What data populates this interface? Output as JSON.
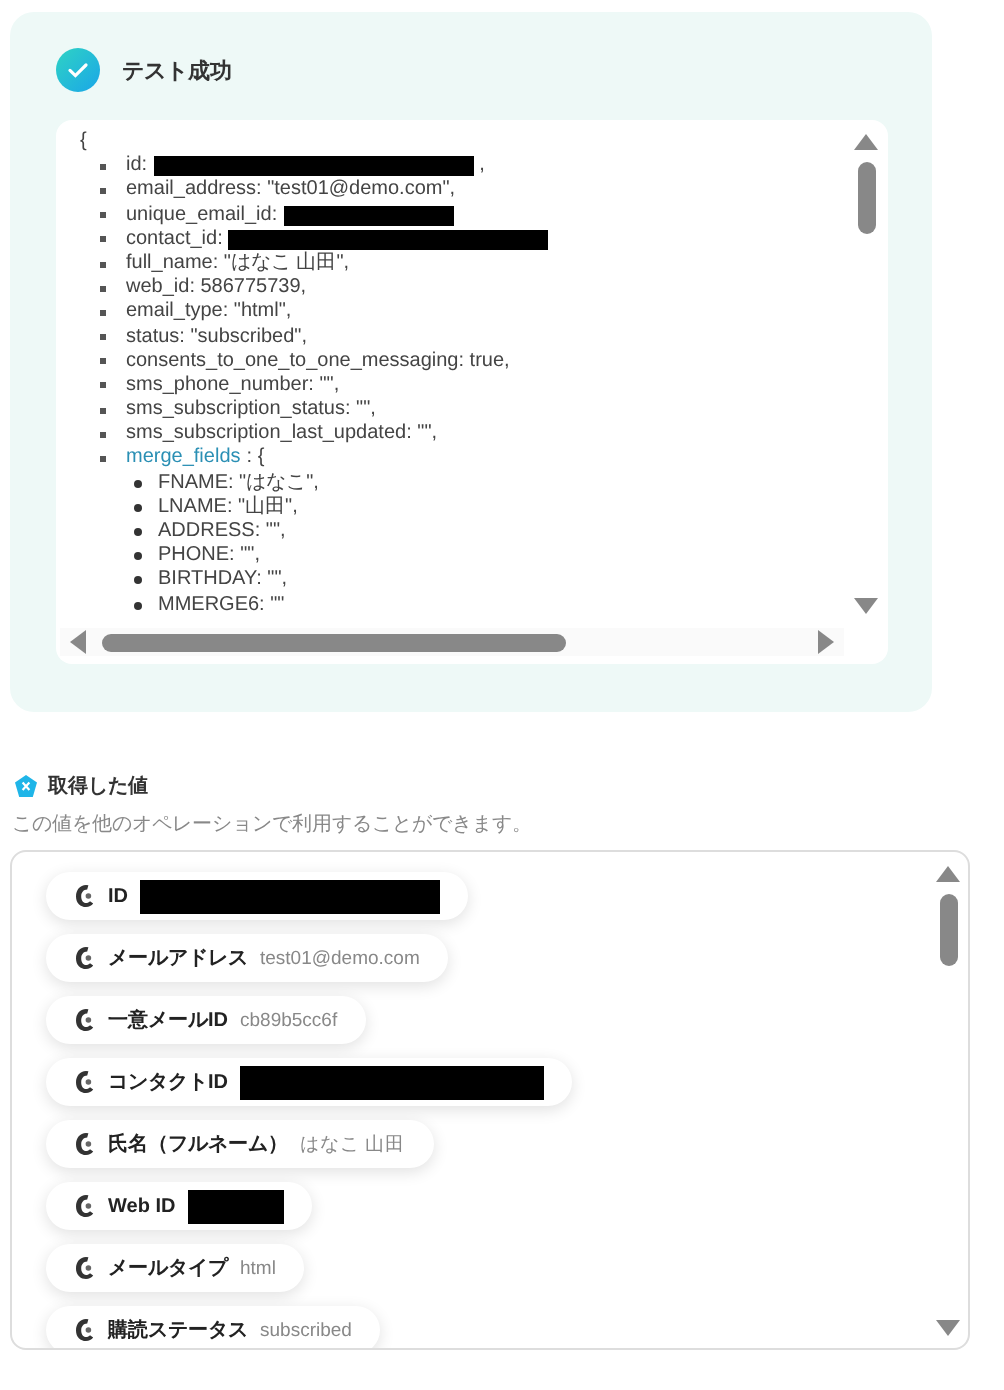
{
  "test_result": {
    "passed": true,
    "title": "テスト成功"
  },
  "json_view": {
    "open": "{",
    "lines": [
      {
        "kind": "redacted",
        "key": "id:",
        "suffix": ","
      },
      {
        "kind": "text",
        "text": "email_address: \"test01@demo.com\","
      },
      {
        "kind": "redacted",
        "key": "unique_email_id:"
      },
      {
        "kind": "redacted",
        "key": "contact_id:"
      },
      {
        "kind": "text",
        "text": "full_name: \"はなこ 山田\","
      },
      {
        "kind": "text",
        "text": "web_id: 586775739,"
      },
      {
        "kind": "text",
        "text": "email_type: \"html\","
      },
      {
        "kind": "text",
        "text": "status: \"subscribed\","
      },
      {
        "kind": "text",
        "text": "consents_to_one_to_one_messaging: true,"
      },
      {
        "kind": "text",
        "text": "sms_phone_number: \"\","
      },
      {
        "kind": "text",
        "text": "sms_subscription_status: \"\","
      },
      {
        "kind": "text",
        "text": "sms_subscription_last_updated: \"\","
      },
      {
        "kind": "object",
        "key": "merge_fields",
        "rest": ": {",
        "children": [
          {
            "text": "FNAME: \"はなこ\","
          },
          {
            "text": "LNAME: \"山田\","
          },
          {
            "text": "ADDRESS: \"\","
          },
          {
            "text": "PHONE: \"\","
          },
          {
            "text": "BIRTHDAY: \"\","
          },
          {
            "text": "MMERGE6: \"\""
          }
        ]
      }
    ]
  },
  "values": {
    "title": "取得した値",
    "description": "この値を他のオペレーションで利用することができます。",
    "items": [
      {
        "label": "ID",
        "kind": "redacted"
      },
      {
        "label": "メールアドレス",
        "kind": "text",
        "value": "test01@demo.com"
      },
      {
        "label": "一意メールID",
        "kind": "text",
        "value": "cb89b5cc6f"
      },
      {
        "label": "コンタクトID",
        "kind": "redacted"
      },
      {
        "label": "氏名（フルネーム）",
        "kind": "text",
        "value": "はなこ 山田"
      },
      {
        "label": "Web ID",
        "kind": "redacted"
      },
      {
        "label": "メールタイプ",
        "kind": "text",
        "value": "html"
      },
      {
        "label": "購読ステータス",
        "kind": "text",
        "value": "subscribed"
      }
    ]
  }
}
